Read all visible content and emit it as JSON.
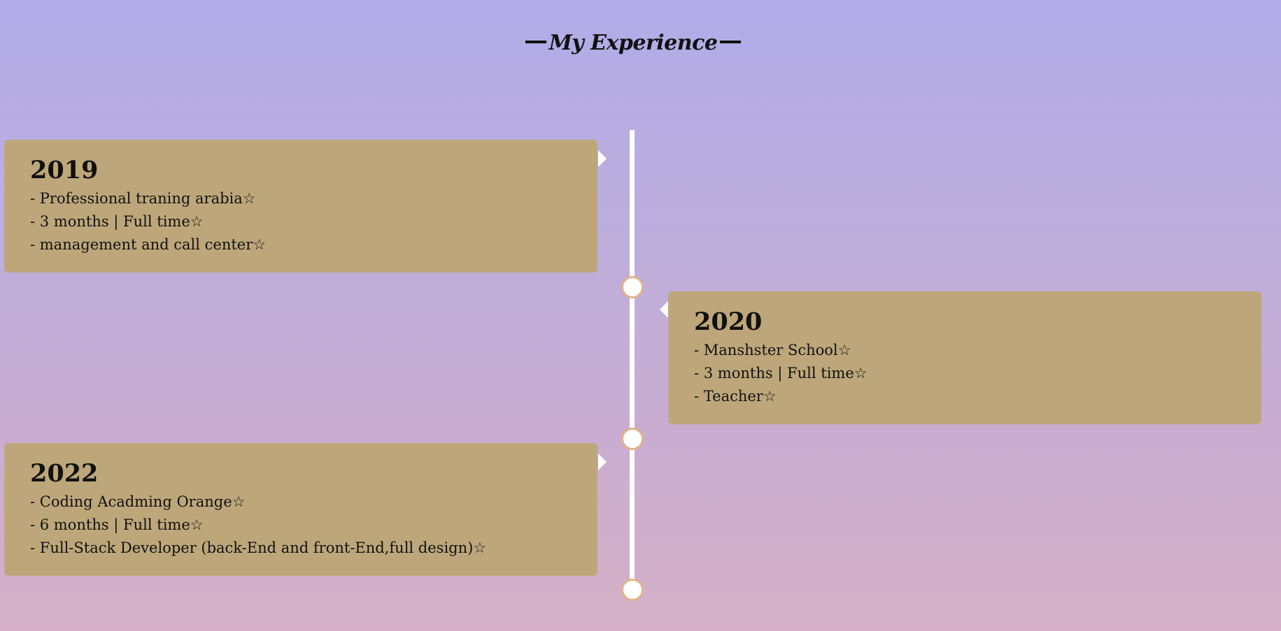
{
  "section": {
    "title": "My Experience"
  },
  "colors": {
    "background_top": "#b2abe8",
    "background_bottom": "#d5b0c6",
    "card": "#bda77a",
    "timeline": "#ffffff",
    "dot_border": "#e2b28a"
  },
  "timeline": {
    "items": [
      {
        "year": "2019",
        "lines": [
          "- Professional traning arabia☆",
          "- 3 months | Full time☆",
          "- management and call center☆"
        ]
      },
      {
        "year": "2020",
        "lines": [
          "- Manshster School☆",
          "- 3 months | Full time☆",
          "- Teacher☆"
        ]
      },
      {
        "year": "2022",
        "lines": [
          "- Coding Acadming Orange☆",
          "- 6 months | Full time☆",
          "- Full-Stack Developer (back-End and front-End,full design)☆"
        ]
      }
    ]
  }
}
